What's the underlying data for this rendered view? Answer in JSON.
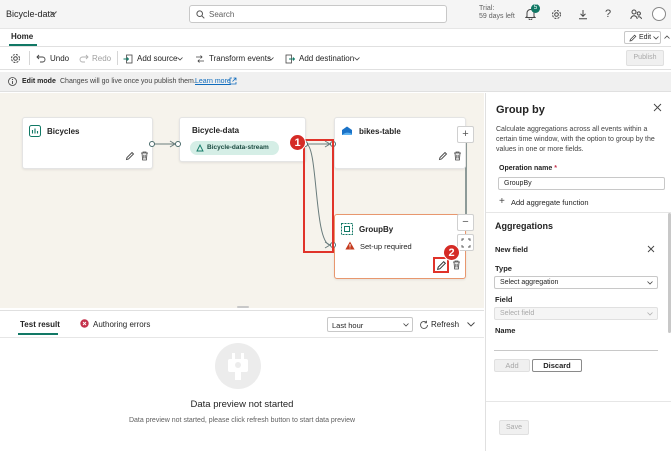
{
  "header": {
    "title": "Bicycle-data",
    "search_placeholder": "Search",
    "trial_line1": "Trial:",
    "trial_line2": "59 days left",
    "notification_count": "5"
  },
  "tabs": {
    "home": "Home",
    "edit": "Edit"
  },
  "toolbar": {
    "undo": "Undo",
    "redo": "Redo",
    "add_source": "Add source",
    "transform_events": "Transform events",
    "add_destination": "Add destination",
    "publish": "Publish"
  },
  "editmode": {
    "label": "Edit mode",
    "message": "Changes will go live once you publish them.",
    "link": "Learn more"
  },
  "nodes": {
    "bicycles": "Bicycles",
    "bicycle_data": "Bicycle-data",
    "stream_chip": "Bicycle-data-stream",
    "bikes_table": "bikes-table",
    "groupby": "GroupBy",
    "setup_required": "Set-up required"
  },
  "callouts": {
    "one": "1",
    "two": "2"
  },
  "bottom": {
    "test_result": "Test result",
    "authoring_errors": "Authoring errors",
    "time_range": "Last hour",
    "refresh": "Refresh",
    "empty_title": "Data preview not started",
    "empty_desc": "Data preview not started, please click refresh button to start data preview"
  },
  "panel": {
    "title": "Group by",
    "description": "Calculate aggregations across all events within a certain time window, with the option to group by the values in one or more fields.",
    "operation_name_label": "Operation name",
    "required_mark": "*",
    "operation_name_value": "GroupBy",
    "add_aggregate": "Add aggregate function",
    "aggregations_header": "Aggregations",
    "new_field": "New field",
    "type_label": "Type",
    "type_placeholder": "Select aggregation",
    "field_label": "Field",
    "field_placeholder": "Select field",
    "name_label": "Name",
    "add_button": "Add",
    "discard_button": "Discard",
    "save_button": "Save"
  },
  "colors": {
    "accent": "#117865",
    "callout": "#d52b26",
    "warning": "#c53a1e"
  }
}
